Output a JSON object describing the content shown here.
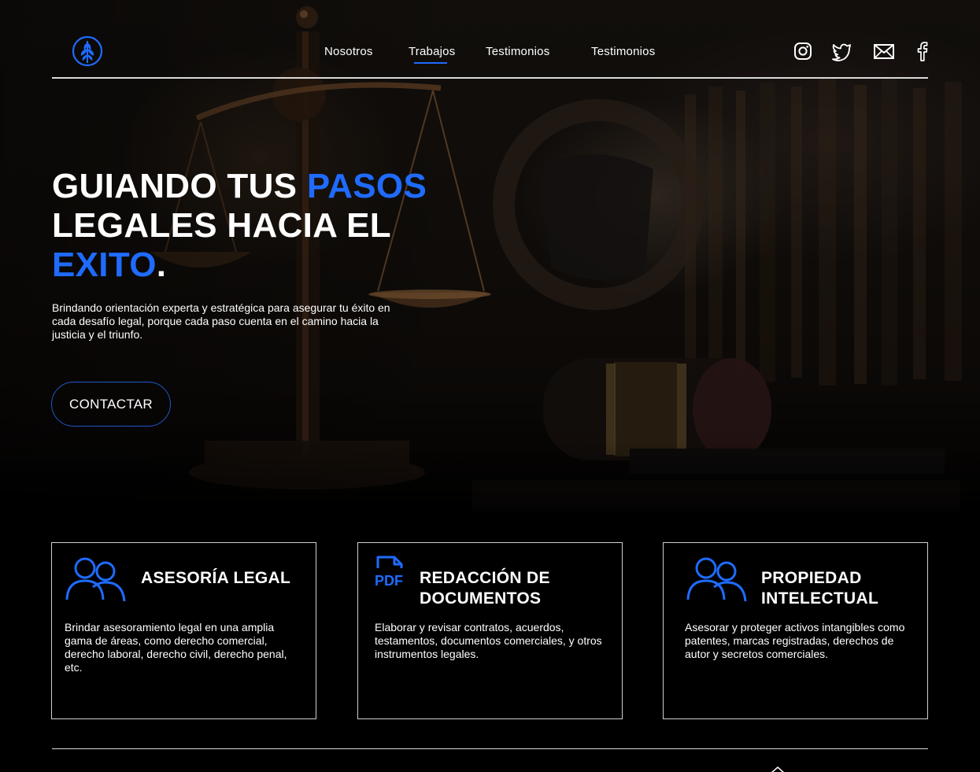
{
  "brand": {
    "logo_icon": "leaf-logo-icon",
    "accent_color": "#1f6bff"
  },
  "nav": {
    "items": [
      {
        "label": "Nosotros"
      },
      {
        "label": "Trabajos",
        "active": true
      },
      {
        "label": "Testimonios"
      },
      {
        "label": "Testimonios"
      }
    ]
  },
  "socials": [
    {
      "icon": "instagram-icon"
    },
    {
      "icon": "twitter-icon"
    },
    {
      "icon": "mail-icon"
    },
    {
      "icon": "facebook-icon"
    }
  ],
  "hero": {
    "headline": {
      "part1": "GUIANDO TUS ",
      "highlight1": "PASOS",
      "part2": "LEGALES HACIA EL",
      "highlight2": "EXITO",
      "end": "."
    },
    "description": "Brindando orientación experta y estratégica para asegurar tu éxito en cada desafío legal, porque cada paso cuenta en el camino hacia la justicia y el triunfo.",
    "cta_label": "CONTACTAR"
  },
  "services": [
    {
      "icon": "users-icon",
      "title": "ASESORÍA LEGAL",
      "description": "Brindar asesoramiento legal en una amplia gama de áreas, como derecho comercial, derecho laboral, derecho civil, derecho penal, etc."
    },
    {
      "icon": "pdf-file-icon",
      "icon_label": "PDF",
      "title": "REDACCIÓN DE DOCUMENTOS",
      "description": "Elaborar y revisar contratos, acuerdos, testamentos, documentos comerciales, y otros instrumentos legales."
    },
    {
      "icon": "users-icon",
      "title": "PROPIEDAD INTELECTUAL",
      "description": "Asesorar y proteger activos intangibles como patentes, marcas registradas, derechos de autor y secretos comerciales."
    }
  ]
}
